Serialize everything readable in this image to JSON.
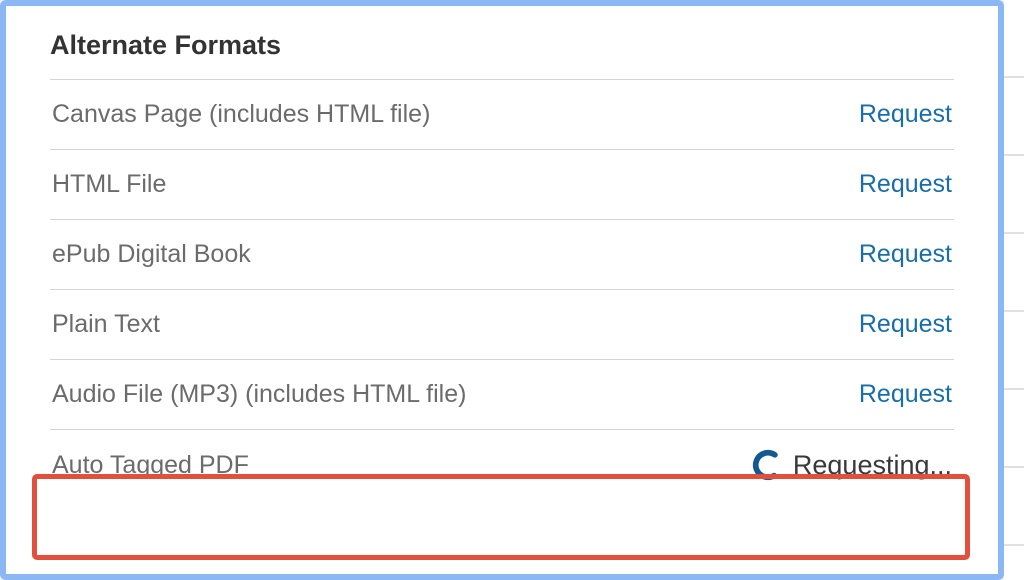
{
  "panel": {
    "title": "Alternate Formats"
  },
  "formats": [
    {
      "label": "Canvas Page (includes HTML file)",
      "action": "Request",
      "state": "idle"
    },
    {
      "label": "HTML File",
      "action": "Request",
      "state": "idle"
    },
    {
      "label": "ePub Digital Book",
      "action": "Request",
      "state": "idle"
    },
    {
      "label": "Plain Text",
      "action": "Request",
      "state": "idle"
    },
    {
      "label": "Audio File (MP3) (includes HTML file)",
      "action": "Request",
      "state": "idle"
    },
    {
      "label": "Auto Tagged PDF",
      "action": "Requesting...",
      "state": "loading"
    }
  ],
  "colors": {
    "frame_border": "#8bb8f4",
    "link": "#1a6ea8",
    "highlight": "#e2503d",
    "spinner": "#125892"
  }
}
